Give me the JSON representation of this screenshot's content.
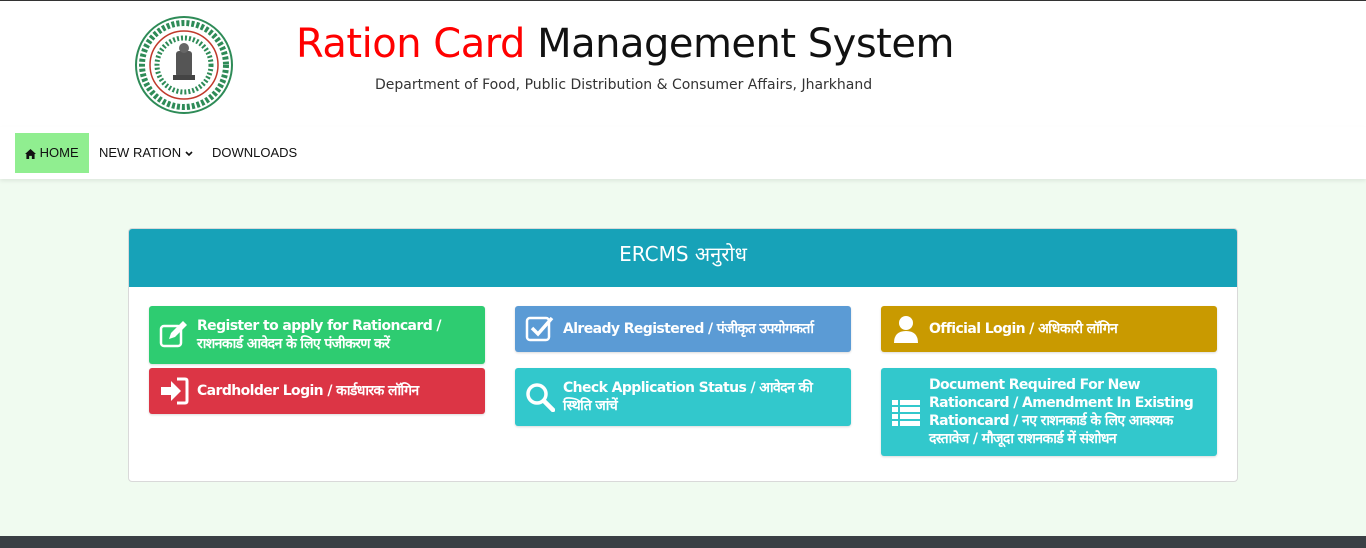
{
  "header": {
    "title_red": "Ration Card",
    "title_black": "Management System",
    "subtitle": "Department of Food, Public Distribution & Consumer Affairs, Jharkhand"
  },
  "nav": {
    "home": "HOME",
    "new_ration": "NEW RATION",
    "downloads": "DOWNLOADS"
  },
  "panel": {
    "heading": "ERCMS अनुरोध",
    "tiles": {
      "register": "Register to apply for Rationcard / राशनकार्ड आवेदन के लिए पंजीकरण करें",
      "cardholder": "Cardholder Login / कार्डधारक लॉगिन",
      "already": "Already Registered / पंजीकृत उपयोगकर्ता",
      "status": "Check Application Status / आवेदन की स्थिति जांचें",
      "official": "Official Login / अधिकारी लॉगिन",
      "docs": "Document Required For New Rationcard / Amendment In Existing Rationcard / नए राशनकार्ड के लिए आवश्यक दस्तावेज / मौजूदा राशनकार्ड में संशोधन"
    }
  },
  "colors": {
    "home_bg": "#90ee90",
    "panel_head": "#17a2b8",
    "register": "#2ecc71",
    "cardholder": "#dc3545",
    "already": "#5b9bd5",
    "status": "#32c8cc",
    "official": "#c99a00",
    "docs": "#32c8cc"
  },
  "icons": {
    "home": "home-icon",
    "new_ration_caret": "chevron-down-icon",
    "register": "edit-icon",
    "cardholder": "sign-in-icon",
    "already": "check-square-icon",
    "status": "search-icon",
    "official": "user-icon",
    "docs": "list-icon",
    "logo": "jharkhand-emblem-icon"
  }
}
